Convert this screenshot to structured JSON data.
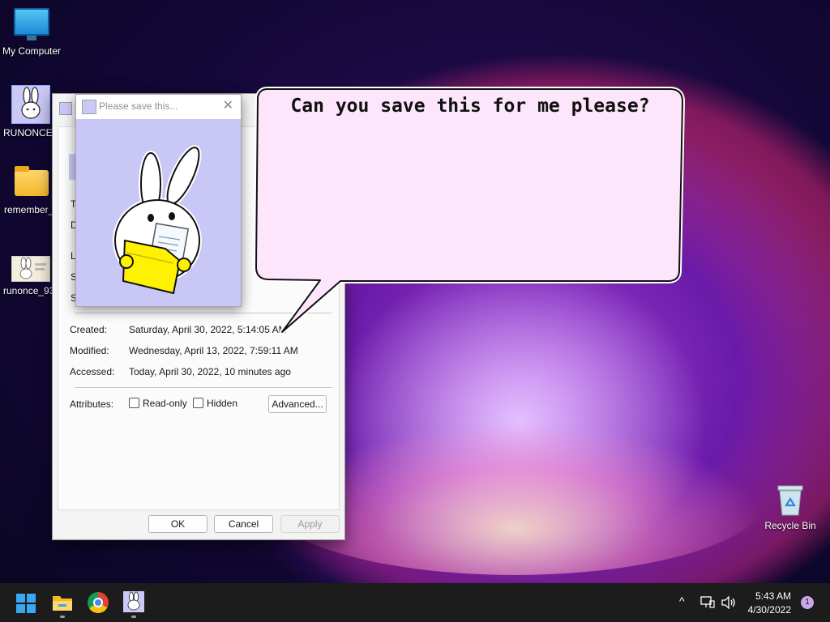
{
  "desktop": {
    "icons": [
      {
        "label": "My Computer",
        "icon": "monitor-icon"
      },
      {
        "label": "RUNONCE.",
        "icon": "bunny-app-icon"
      },
      {
        "label": "remember_",
        "icon": "folder-icon"
      },
      {
        "label": "runonce_93",
        "icon": "image-file-icon"
      },
      {
        "label": "Recycle Bin",
        "icon": "recycle-bin-icon"
      }
    ]
  },
  "properties_window": {
    "tab_label_partial": "Ge",
    "partial_right_text": "revi",
    "partial_labels": [
      "Ty",
      "D",
      "Lo",
      "Si",
      "Si"
    ],
    "created_label": "Created:",
    "created_value": "Saturday, April 30, 2022, 5:14:05 AM",
    "modified_label": "Modified:",
    "modified_value": "Wednesday, April 13, 2022, 7:59:11 AM",
    "accessed_label": "Accessed:",
    "accessed_value": "Today, April 30, 2022, 10 minutes ago",
    "attributes_label": "Attributes:",
    "readonly_label": "Read-only",
    "hidden_label": "Hidden",
    "advanced_button": "Advanced...",
    "ok_button": "OK",
    "cancel_button": "Cancel",
    "apply_button": "Apply"
  },
  "popup": {
    "title": "Please save this...",
    "close_glyph": "✕"
  },
  "speech_bubble": {
    "text": "Can you save this for me please?"
  },
  "taskbar": {
    "items": [
      "start-icon",
      "file-explorer-icon",
      "chrome-icon",
      "runonce-bunny-icon"
    ],
    "time": "5:43 AM",
    "date": "4/30/2022",
    "notification_count": "1",
    "tray_chevron": "^"
  },
  "colors": {
    "accent": "#3aa8f0",
    "bubble_fill": "#fde6fb",
    "popup_art_bg": "#c8c7f5"
  }
}
